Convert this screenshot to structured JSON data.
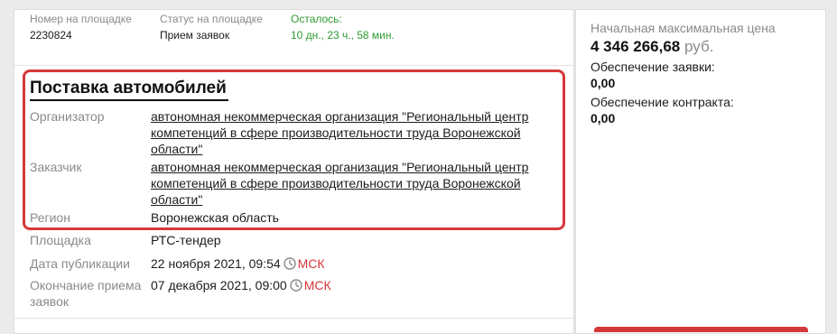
{
  "meta": {
    "number_label": "Номер на площадке",
    "number_value": "2230824",
    "status_label": "Статус на площадке",
    "status_value": "Прием заявок",
    "remaining_label": "Осталось:",
    "remaining_value": "10 дн., 23 ч., 58 мин."
  },
  "tender": {
    "title": "Поставка автомобилей",
    "organizer_label": "Организатор",
    "organizer_value": "автономная некоммерческая организация \"Региональный центр компетенций в сфере производительности труда Воронежской области\"",
    "customer_label": "Заказчик",
    "customer_value": "автономная некоммерческая организация \"Региональный центр компетенций в сфере производительности труда Воронежской области\"",
    "region_label": "Регион",
    "region_value": "Воронежская область",
    "platform_label": "Площадка",
    "platform_value": "РТС-тендер",
    "publication_label": "Дата публикации",
    "publication_value": "22 ноября 2021, 09:54",
    "end_label": "Окончание приема заявок",
    "end_value": "07 декабря 2021, 09:00",
    "timezone": "МСК"
  },
  "side": {
    "price_label": "Начальная максимальная цена",
    "price_value": "4 346 266,68",
    "price_currency": "руб.",
    "bid_security_label": "Обеспечение заявки:",
    "bid_security_value": "0,00",
    "contract_security_label": "Обеспечение контракта:",
    "contract_security_value": "0,00"
  },
  "colors": {
    "accent_red": "#d5383a",
    "status_green": "#2e9b33",
    "muted_text": "#8a8a8a"
  }
}
